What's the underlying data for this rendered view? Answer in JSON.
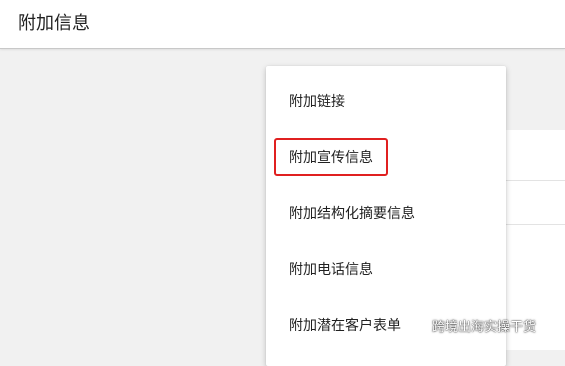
{
  "header": {
    "title": "附加信息"
  },
  "menu": {
    "items": [
      {
        "label": "附加链接"
      },
      {
        "label": "附加宣传信息",
        "highlighted": true
      },
      {
        "label": "附加结构化摘要信息"
      },
      {
        "label": "附加电话信息"
      },
      {
        "label": "附加潜在客户表单"
      }
    ]
  },
  "annotation": {
    "color": "#e02020"
  },
  "watermark": {
    "icon": "wechat-icon",
    "text": "跨境出海实操干货"
  }
}
